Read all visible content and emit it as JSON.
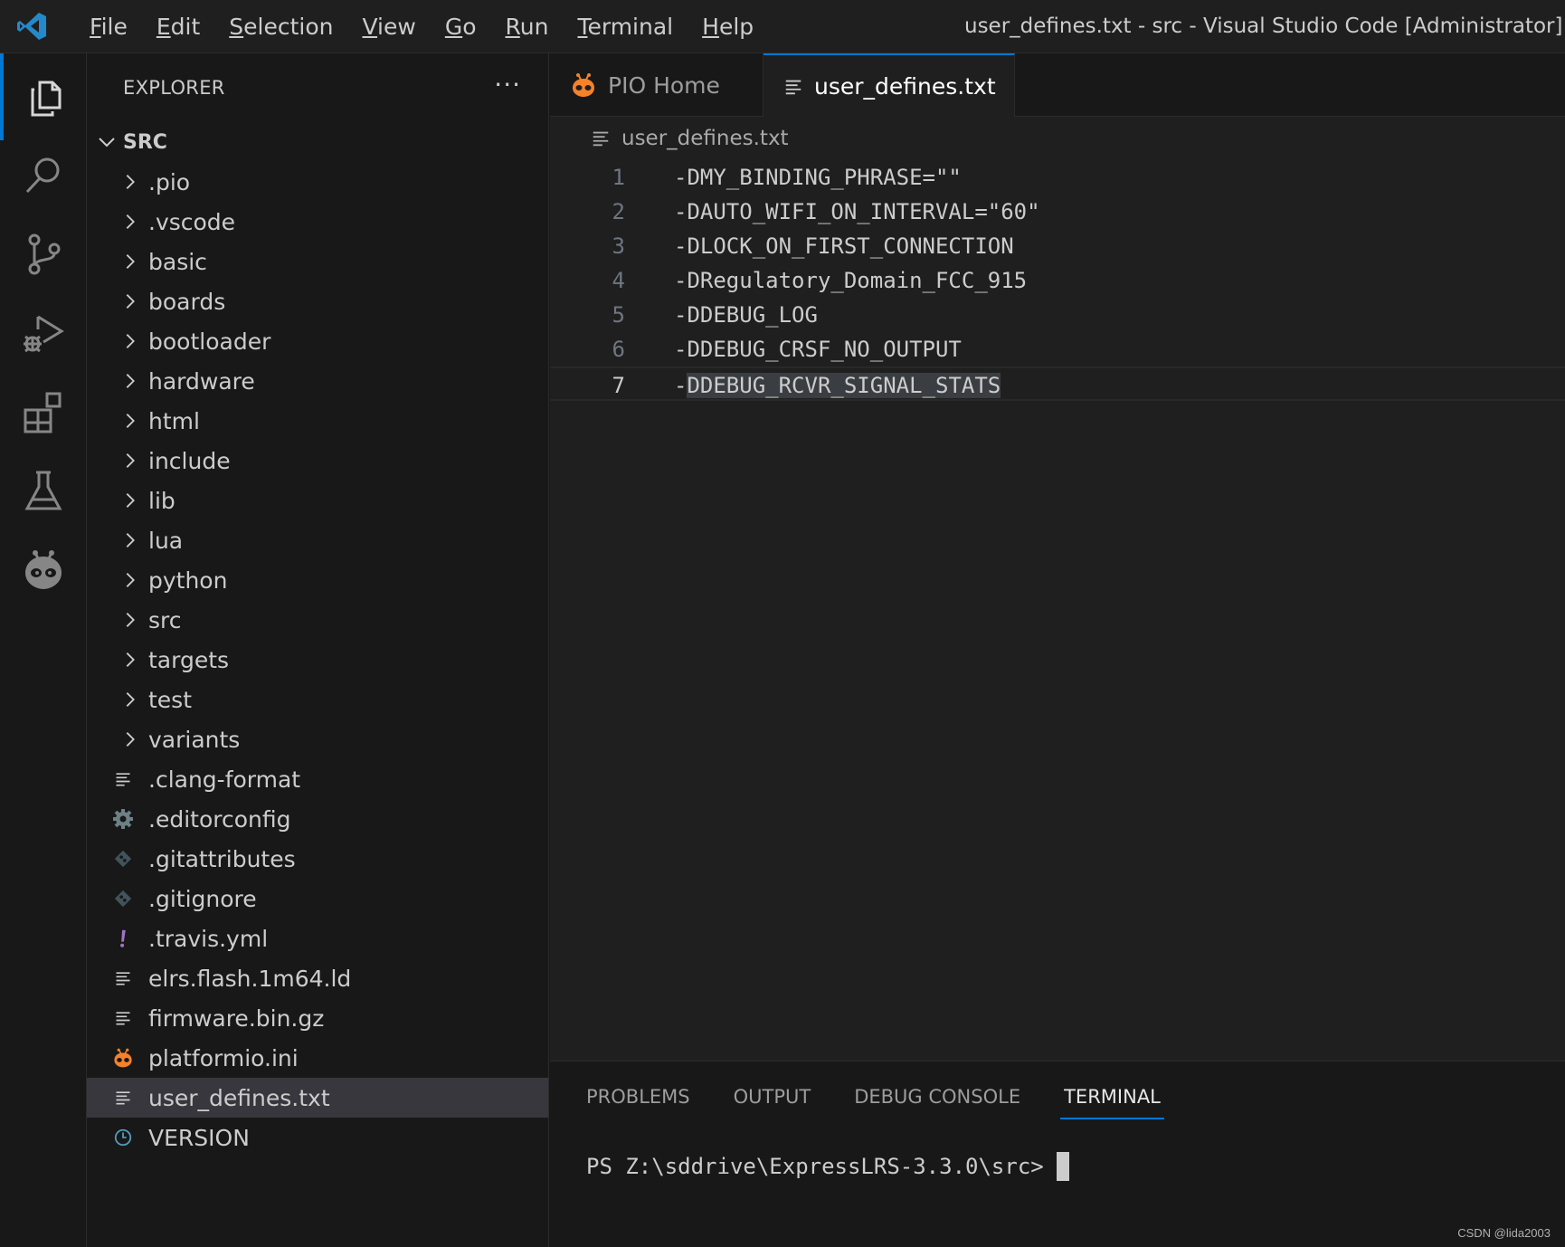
{
  "titlebar": {
    "menu": [
      "File",
      "Edit",
      "Selection",
      "View",
      "Go",
      "Run",
      "Terminal",
      "Help"
    ],
    "window_title": "user_defines.txt - src - Visual Studio Code [Administrator]"
  },
  "activity_bar": {
    "items": [
      "explorer-icon",
      "search-icon",
      "source-control-icon",
      "run-debug-icon",
      "extensions-icon",
      "testing-icon",
      "platformio-icon"
    ],
    "active": "explorer-icon"
  },
  "sidebar": {
    "header": "EXPLORER",
    "more": "···",
    "root": "SRC",
    "folders": [
      ".pio",
      ".vscode",
      "basic",
      "boards",
      "bootloader",
      "hardware",
      "html",
      "include",
      "lib",
      "lua",
      "python",
      "src",
      "targets",
      "test",
      "variants"
    ],
    "files": [
      {
        "name": ".clang-format",
        "icon": "text-file-icon"
      },
      {
        "name": ".editorconfig",
        "icon": "gear-icon"
      },
      {
        "name": ".gitattributes",
        "icon": "git-icon"
      },
      {
        "name": ".gitignore",
        "icon": "git-icon"
      },
      {
        "name": ".travis.yml",
        "icon": "exclamation-icon"
      },
      {
        "name": "elrs.flash.1m64.ld",
        "icon": "text-file-icon"
      },
      {
        "name": "firmware.bin.gz",
        "icon": "text-file-icon"
      },
      {
        "name": "platformio.ini",
        "icon": "platformio-icon"
      },
      {
        "name": "user_defines.txt",
        "icon": "text-file-icon"
      },
      {
        "name": "VERSION",
        "icon": "clock-icon"
      }
    ],
    "selected_file": "user_defines.txt"
  },
  "tabs": [
    {
      "label": "PIO Home",
      "active": false
    },
    {
      "label": "user_defines.txt",
      "active": true
    }
  ],
  "editor": {
    "breadcrumb": "user_defines.txt",
    "lines": [
      "-DMY_BINDING_PHRASE=\"\"",
      "-DAUTO_WIFI_ON_INTERVAL=\"60\"",
      "-DLOCK_ON_FIRST_CONNECTION",
      "-DRegulatory_Domain_FCC_915",
      "-DDEBUG_LOG",
      "-DDEBUG_CRSF_NO_OUTPUT",
      "-DDEBUG_RCVR_SIGNAL_STATS"
    ],
    "current_line": 7,
    "selection_prefix": "-",
    "selection_text": "DDEBUG_RCVR_SIGNAL_STATS"
  },
  "panel": {
    "tabs": [
      "PROBLEMS",
      "OUTPUT",
      "DEBUG CONSOLE",
      "TERMINAL"
    ],
    "active_tab": "TERMINAL",
    "terminal_prompt": "PS Z:\\sddrive\\ExpressLRS-3.3.0\\src>"
  },
  "watermark": "CSDN @lida2003",
  "colors": {
    "accent": "#0078d4",
    "platformio_orange": "#f5822a",
    "git_icon": "#41535b",
    "yaml_icon": "#a074c4",
    "version_icon": "#519aba"
  }
}
